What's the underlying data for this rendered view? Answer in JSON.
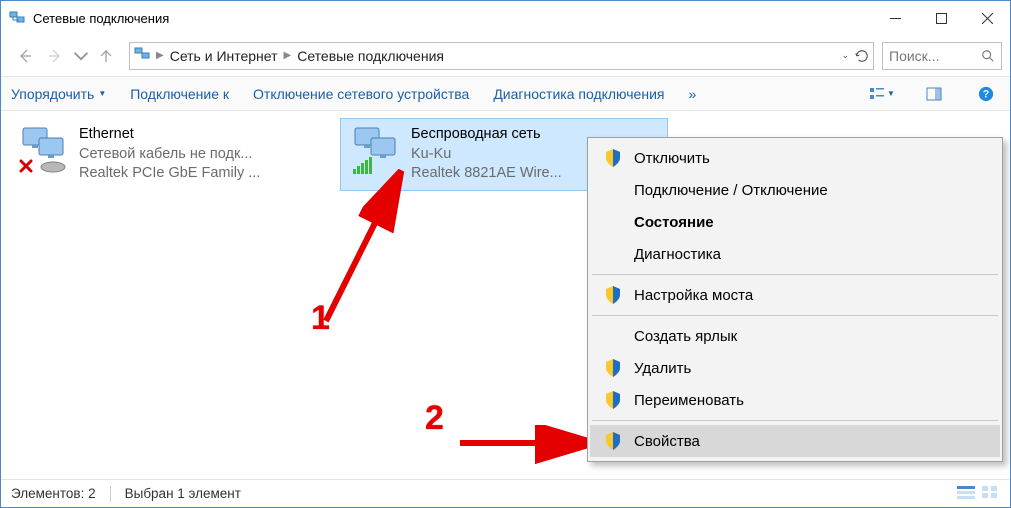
{
  "window": {
    "title": "Сетевые подключения"
  },
  "breadcrumbs": {
    "seg1": "Сеть и Интернет",
    "seg2": "Сетевые подключения"
  },
  "search": {
    "placeholder": "Поиск..."
  },
  "toolbar": {
    "organize": "Упорядочить",
    "connect_to": "Подключение к",
    "disable_device": "Отключение сетевого устройства",
    "diagnose": "Диагностика подключения",
    "overflow": "»"
  },
  "connections": {
    "ethernet": {
      "name": "Ethernet",
      "status": "Сетевой кабель не подк...",
      "device": "Realtek PCIe GbE Family ..."
    },
    "wifi": {
      "name": "Беспроводная сеть",
      "status": "Ku-Ku",
      "device": "Realtek 8821AE Wire..."
    }
  },
  "context_menu": {
    "disable": "Отключить",
    "conn_disconn": "Подключение / Отключение",
    "state": "Состояние",
    "diagnostics": "Диагностика",
    "bridge": "Настройка моста",
    "shortcut": "Создать ярлык",
    "delete": "Удалить",
    "rename": "Переименовать",
    "properties": "Свойства"
  },
  "statusbar": {
    "elements": "Элементов: 2",
    "selected": "Выбран 1 элемент"
  },
  "annotations": {
    "num1": "1",
    "num2": "2"
  }
}
